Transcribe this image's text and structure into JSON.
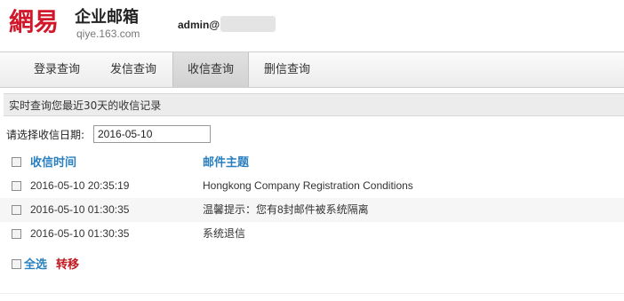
{
  "brand": {
    "logo_text": "網易",
    "title": "企业邮箱",
    "subtitle": "qiye.163.com"
  },
  "user": {
    "name": "admin@"
  },
  "tabs": [
    {
      "label": "登录查询"
    },
    {
      "label": "发信查询"
    },
    {
      "label": "收信查询",
      "active": true
    },
    {
      "label": "删信查询"
    }
  ],
  "info": {
    "text": "实时查询您最近30天的收信记录"
  },
  "date_filter": {
    "label": "请选择收信日期:",
    "value": "2016-05-10"
  },
  "table": {
    "headers": {
      "time": "收信时间",
      "subject": "邮件主题"
    },
    "rows": [
      {
        "time": "2016-05-10 20:35:19",
        "subject": "Hongkong Company Registration Conditions"
      },
      {
        "time": "2016-05-10 01:30:35",
        "subject": "温馨提示：您有8封邮件被系统隔离"
      },
      {
        "time": "2016-05-10 01:30:35",
        "subject": "系统退信"
      }
    ]
  },
  "actions": {
    "select_all": "全选",
    "transfer": "转移"
  },
  "colors": {
    "brand_red": "#d1172a",
    "link_blue": "#2a7fbf",
    "action_red": "#c0181f"
  }
}
